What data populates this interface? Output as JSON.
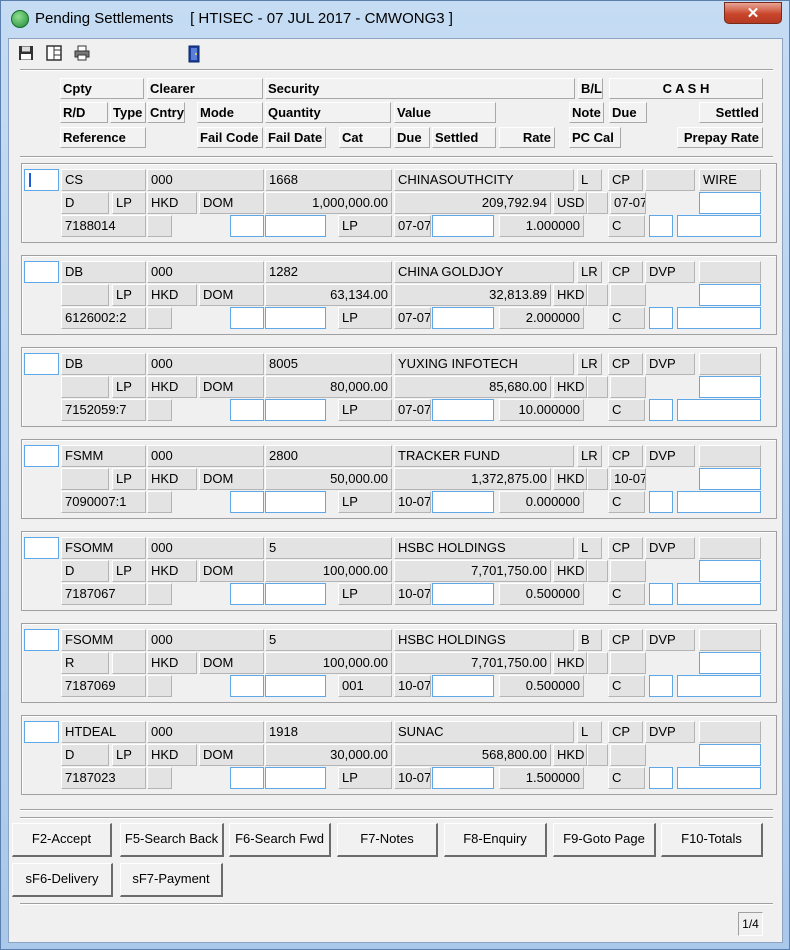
{
  "window": {
    "title": "Pending Settlements    [ HTISEC - 07 JUL 2017 - CMWONG3 ]",
    "close": "✕"
  },
  "toolbar": {
    "save_icon": "floppy-disk-icon",
    "layout_icon": "column-layout-icon",
    "print_icon": "printer-icon",
    "exit_icon": "exit-door-icon"
  },
  "headers": {
    "cpty": "Cpty",
    "clearer": "Clearer",
    "security": "Security",
    "bl": "B/L",
    "cash": "C A S H",
    "rd": "R/D",
    "type": "Type",
    "cntry": "Cntry",
    "mode": "Mode",
    "quantity": "Quantity",
    "value": "Value",
    "note": "Note",
    "due": "Due",
    "settled": "Settled",
    "reference": "Reference",
    "fail_code": "Fail Code",
    "fail_date": "Fail Date",
    "cat": "Cat",
    "due2": "Due",
    "settled2": "Settled",
    "rate": "Rate",
    "pc_cal": "PC Cal",
    "prepay_rate": "Prepay Rate"
  },
  "records": [
    {
      "cpty": "CS",
      "clearer": "000",
      "code": "1668",
      "security": "CHINASOUTHCITY",
      "bl": "L",
      "cp": "CP",
      "mode2": "",
      "wire": "WIRE",
      "rd": "D",
      "type": "LP",
      "cntry": "HKD",
      "mode": "DOM",
      "quantity": "1,000,000.00",
      "value": "209,792.94",
      "ccy": "USD",
      "due_date": "07-07",
      "reference": "7188014",
      "cat": "LP",
      "due": "07-07",
      "rate": "1.000000",
      "pc": "C"
    },
    {
      "cpty": "DB",
      "clearer": "000",
      "code": "1282",
      "security": "CHINA GOLDJOY",
      "bl": "LR",
      "cp": "CP",
      "mode2": "DVP",
      "wire": "",
      "rd": "",
      "type": "LP",
      "cntry": "HKD",
      "mode": "DOM",
      "quantity": "63,134.00",
      "value": "32,813.89",
      "ccy": "HKD",
      "due_date": "",
      "reference": "6126002:2",
      "cat": "LP",
      "due": "07-07",
      "rate": "2.000000",
      "pc": "C"
    },
    {
      "cpty": "DB",
      "clearer": "000",
      "code": "8005",
      "security": "YUXING INFOTECH",
      "bl": "LR",
      "cp": "CP",
      "mode2": "DVP",
      "wire": "",
      "rd": "",
      "type": "LP",
      "cntry": "HKD",
      "mode": "DOM",
      "quantity": "80,000.00",
      "value": "85,680.00",
      "ccy": "HKD",
      "due_date": "",
      "reference": "7152059:7",
      "cat": "LP",
      "due": "07-07",
      "rate": "10.000000",
      "pc": "C"
    },
    {
      "cpty": "FSMM",
      "clearer": "000",
      "code": "2800",
      "security": "TRACKER FUND",
      "bl": "LR",
      "cp": "CP",
      "mode2": "DVP",
      "wire": "",
      "rd": "",
      "type": "LP",
      "cntry": "HKD",
      "mode": "DOM",
      "quantity": "50,000.00",
      "value": "1,372,875.00",
      "ccy": "HKD",
      "due_date": "10-07",
      "reference": "7090007:1",
      "cat": "LP",
      "due": "10-07",
      "rate": "0.000000",
      "pc": "C"
    },
    {
      "cpty": "FSOMM",
      "clearer": "000",
      "code": "5",
      "security": "HSBC HOLDINGS",
      "bl": "L",
      "cp": "CP",
      "mode2": "DVP",
      "wire": "",
      "rd": "D",
      "type": "LP",
      "cntry": "HKD",
      "mode": "DOM",
      "quantity": "100,000.00",
      "value": "7,701,750.00",
      "ccy": "HKD",
      "due_date": "",
      "reference": "7187067",
      "cat": "LP",
      "due": "10-07",
      "rate": "0.500000",
      "pc": "C"
    },
    {
      "cpty": "FSOMM",
      "clearer": "000",
      "code": "5",
      "security": "HSBC HOLDINGS",
      "bl": "B",
      "cp": "CP",
      "mode2": "DVP",
      "wire": "",
      "rd": "R",
      "type": "",
      "cntry": "HKD",
      "mode": "DOM",
      "quantity": "100,000.00",
      "value": "7,701,750.00",
      "ccy": "HKD",
      "due_date": "",
      "reference": "7187069",
      "cat": "001",
      "due": "10-07",
      "rate": "0.500000",
      "pc": "C"
    },
    {
      "cpty": "HTDEAL",
      "clearer": "000",
      "code": "1918",
      "security": "SUNAC",
      "bl": "L",
      "cp": "CP",
      "mode2": "DVP",
      "wire": "",
      "rd": "D",
      "type": "LP",
      "cntry": "HKD",
      "mode": "DOM",
      "quantity": "30,000.00",
      "value": "568,800.00",
      "ccy": "HKD",
      "due_date": "",
      "reference": "7187023",
      "cat": "LP",
      "due": "10-07",
      "rate": "1.500000",
      "pc": "C"
    }
  ],
  "buttons": {
    "accept": "F2-Accept",
    "search_back": "F5-Search Back",
    "search_fwd": "F6-Search Fwd",
    "notes": "F7-Notes",
    "enquiry": "F8-Enquiry",
    "goto_page": "F9-Goto Page",
    "totals": "F10-Totals",
    "delivery": "sF6-Delivery",
    "payment": "sF7-Payment"
  },
  "status": {
    "page": "1/4"
  }
}
